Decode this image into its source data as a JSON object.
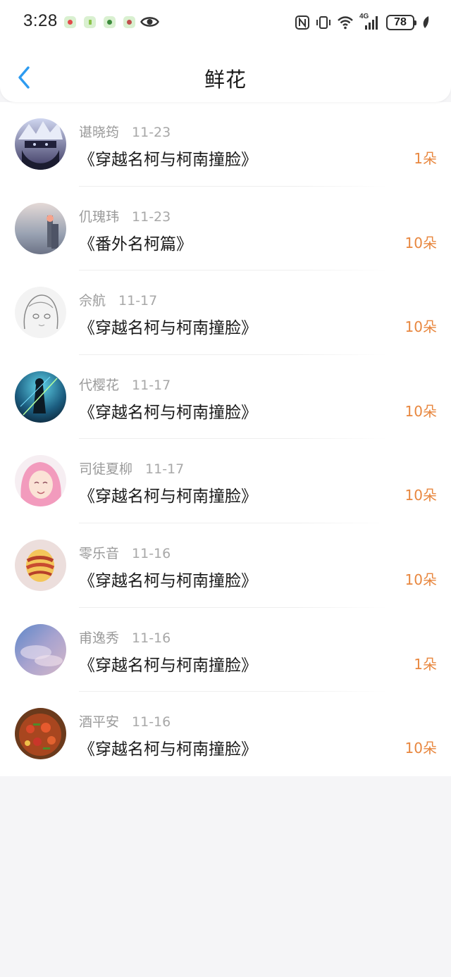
{
  "status_bar": {
    "time": "3:28",
    "battery": "78",
    "network_label": "4G",
    "icons": [
      "nfc-icon",
      "vibrate-icon",
      "wifi-icon",
      "signal-icon",
      "leaf-icon"
    ]
  },
  "header": {
    "title": "鲜花",
    "back_icon": "chevron-left-icon"
  },
  "colors": {
    "accent": "#2d9bf0",
    "amount": "#e8873f",
    "muted_text": "#9a9a9a"
  },
  "items": [
    {
      "name": "谌晓筠",
      "date": "11-23",
      "book": "《穿越名柯与柯南撞脸》",
      "amount": "1朵"
    },
    {
      "name": "仉瑰玮",
      "date": "11-23",
      "book": "《番外名柯篇》",
      "amount": "10朵"
    },
    {
      "name": "佘航",
      "date": "11-17",
      "book": "《穿越名柯与柯南撞脸》",
      "amount": "10朵"
    },
    {
      "name": "代樱花",
      "date": "11-17",
      "book": "《穿越名柯与柯南撞脸》",
      "amount": "10朵"
    },
    {
      "name": "司徒夏柳",
      "date": "11-17",
      "book": "《穿越名柯与柯南撞脸》",
      "amount": "10朵"
    },
    {
      "name": "零乐音",
      "date": "11-16",
      "book": "《穿越名柯与柯南撞脸》",
      "amount": "10朵"
    },
    {
      "name": "甫逸秀",
      "date": "11-16",
      "book": "《穿越名柯与柯南撞脸》",
      "amount": "1朵"
    },
    {
      "name": "酒平安",
      "date": "11-16",
      "book": "《穿越名柯与柯南撞脸》",
      "amount": "10朵"
    }
  ]
}
